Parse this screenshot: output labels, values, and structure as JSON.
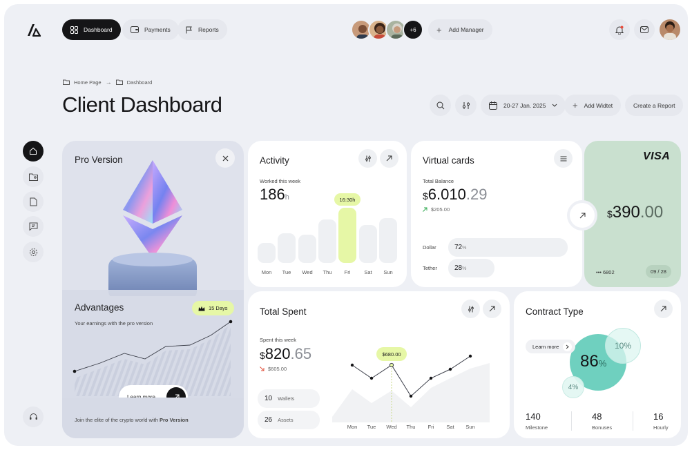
{
  "nav": {
    "dashboard": "Dashboard",
    "payments": "Payments",
    "reports": "Reports",
    "extra_avatars": "+6",
    "add_manager": "Add Manager"
  },
  "breadcrumb": {
    "home": "Home Page",
    "arrow": "→",
    "current": "Dashboard"
  },
  "page_title": "Client Dashboard",
  "toolbar": {
    "date_range": "20-27 Jan. 2025",
    "add_widget": "Add Widtet",
    "create_report": "Create a Report"
  },
  "pro": {
    "title": "Pro Version",
    "advantages_title": "Advantages",
    "badge": "15 Days",
    "subtitle": "Your earnings with the pro version",
    "learn_more": "Learn more",
    "footer_prefix": "Join the elite of the crypto world with ",
    "footer_bold": "Pro Version"
  },
  "activity": {
    "title": "Activity",
    "label": "Worked this week",
    "value": "186",
    "unit": "h",
    "tooltip": "16:30h",
    "days": [
      "Mon",
      "Tue",
      "Wed",
      "Thu",
      "Fri",
      "Sat",
      "Sun"
    ],
    "highlight_index": 4
  },
  "virtual_cards": {
    "title": "Virtual cards",
    "balance_label": "Total Balance",
    "currency": "$",
    "balance_int": "6.010",
    "balance_dec": ".29",
    "change": "$205.00",
    "rows": [
      {
        "name": "Dollar",
        "value": "72",
        "unit": "%",
        "fraction": 0.72
      },
      {
        "name": "Tether",
        "value": "28",
        "unit": "%",
        "fraction": 0.28
      }
    ]
  },
  "visa": {
    "brand": "VISA",
    "currency": "$",
    "amount_int": "390",
    "amount_dec": ".00",
    "masked": "••• 6802",
    "expiry": "09 / 28"
  },
  "total_spent": {
    "title": "Total Spent",
    "label": "Spent this week",
    "currency": "$",
    "value_int": "820",
    "value_dec": ".65",
    "change": "$605.00",
    "tooltip": "$680.00",
    "stats": [
      {
        "value": "10",
        "label": "Wallets"
      },
      {
        "value": "26",
        "label": "Assets"
      }
    ],
    "days": [
      "Mon",
      "Tue",
      "Wed",
      "Thu",
      "Fri",
      "Sat",
      "Sun"
    ]
  },
  "contract": {
    "title": "Contract Type",
    "learn_more": "Learn more",
    "main_value": "86",
    "main_unit": "%",
    "secondary": "10%",
    "tertiary": "4%",
    "stats": [
      {
        "value": "140",
        "label": "Milestone"
      },
      {
        "value": "48",
        "label": "Bonuses"
      },
      {
        "value": "16",
        "label": "Hourly"
      }
    ]
  },
  "chart_data": [
    {
      "type": "bar",
      "title": "Activity",
      "categories": [
        "Mon",
        "Tue",
        "Wed",
        "Thu",
        "Fri",
        "Sat",
        "Sun"
      ],
      "values": [
        6,
        9,
        8.5,
        13,
        16.5,
        11.5,
        13.5
      ],
      "annotation": "16:30h"
    },
    {
      "type": "line",
      "title": "Total Spent",
      "x": [
        "",
        "Mon",
        "Tue",
        "Wed",
        "Thu",
        "Fri",
        "Sat",
        "Sun",
        ""
      ],
      "values": [
        3,
        6.5,
        5,
        6.5,
        3,
        5,
        6,
        7.5,
        9
      ],
      "annotation": "$680.00"
    }
  ]
}
